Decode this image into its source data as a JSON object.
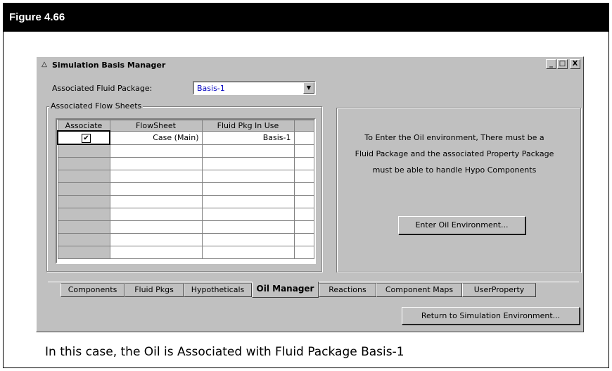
{
  "figure": {
    "title": "Figure 4.66",
    "caption": "In this case, the Oil is Associated with Fluid Package Basis-1"
  },
  "window": {
    "title": "Simulation Basis Manager",
    "minimize": "_",
    "maximize": "□",
    "close": "X"
  },
  "fluid_package": {
    "label": "Associated Fluid Package:",
    "value": "Basis-1"
  },
  "flowsheets": {
    "group_label": "Associated Flow Sheets",
    "columns": [
      "Associate",
      "FlowSheet",
      "Fluid Pkg In Use",
      ""
    ],
    "rows": [
      {
        "associate": true,
        "flowsheet": "Case (Main)",
        "fluid_pkg": "Basis-1"
      }
    ]
  },
  "oil_info": {
    "lines": [
      "To Enter the Oil environment,  There must be a",
      "Fluid Package and  the associated Property Package",
      "must be able to handle Hypo Components"
    ],
    "button": "Enter Oil Environment..."
  },
  "tabs": [
    {
      "label": "Components",
      "active": false
    },
    {
      "label": "Fluid Pkgs",
      "active": false
    },
    {
      "label": "Hypotheticals",
      "active": false
    },
    {
      "label": "Oil Manager",
      "active": true
    },
    {
      "label": "Reactions",
      "active": false
    },
    {
      "label": "Component Maps",
      "active": false
    },
    {
      "label": "UserProperty",
      "active": false
    }
  ],
  "return_button": "Return to Simulation Environment...",
  "icons": {
    "app": "flask-icon",
    "checkbox": "check-icon",
    "dropdown": "chevron-down-icon"
  }
}
